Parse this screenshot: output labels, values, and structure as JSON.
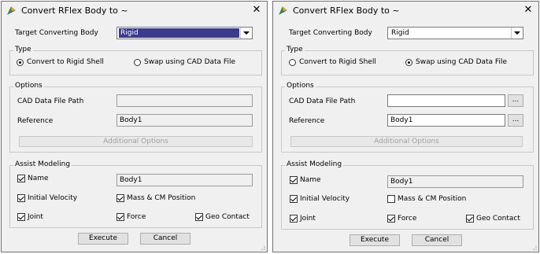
{
  "dialogs": [
    {
      "title": "Convert RFlex Body to ~",
      "target_label": "Target Converting Body",
      "target_value": "Rigid",
      "type_group": "Type",
      "type_options": [
        "Convert to Rigid Shell",
        "Swap using CAD Data File"
      ],
      "type_selected": "Convert to Rigid Shell",
      "options_group": "Options",
      "cad_label": "CAD Data File Path",
      "cad_value": "",
      "reference_label": "Reference",
      "reference_value": "Body1",
      "additional_label": "Additional Options",
      "assist_group": "Assist Modeling",
      "name_label": "Name",
      "name_value": "Body1",
      "velocity_label": "Initial Velocity",
      "mass_label": "Mass & CM Position",
      "joint_label": "Joint",
      "force_label": "Force",
      "geo_label": "Geo Contact",
      "checked": {
        "name": true,
        "velocity": true,
        "mass": true,
        "joint": true,
        "force": true,
        "geo": true
      },
      "execute_label": "Execute",
      "cancel_label": "Cancel"
    },
    {
      "title": "Convert RFlex Body to ~",
      "target_label": "Target Converting Body",
      "target_value": "Rigid",
      "type_group": "Type",
      "type_options": [
        "Convert to Rigid Shell",
        "Swap using CAD Data File"
      ],
      "type_selected": "Swap using CAD Data File",
      "options_group": "Options",
      "cad_label": "CAD Data File Path",
      "cad_value": "",
      "browse_label": "...",
      "reference_label": "Reference",
      "reference_value": "Body1",
      "additional_label": "Additional Options",
      "assist_group": "Assist Modeling",
      "name_label": "Name",
      "name_value": "Body1",
      "velocity_label": "Initial Velocity",
      "mass_label": "Mass & CM Position",
      "joint_label": "Joint",
      "force_label": "Force",
      "geo_label": "Geo Contact",
      "checked": {
        "name": true,
        "velocity": true,
        "mass": false,
        "joint": true,
        "force": true,
        "geo": true
      },
      "execute_label": "Execute",
      "cancel_label": "Cancel"
    }
  ],
  "colors": {
    "selection": "#3a3a8e",
    "window_bg": "#f0f0f0",
    "border": "#707070"
  }
}
